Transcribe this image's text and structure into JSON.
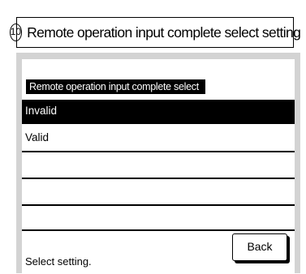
{
  "header": {
    "number": "10",
    "title": "Remote operation input complete select setting"
  },
  "section": {
    "label": "Remote operation input complete select"
  },
  "options": [
    {
      "label": "Invalid",
      "selected": true
    },
    {
      "label": "Valid",
      "selected": false
    }
  ],
  "footer": {
    "status": "Select setting.",
    "back_label": "Back"
  }
}
